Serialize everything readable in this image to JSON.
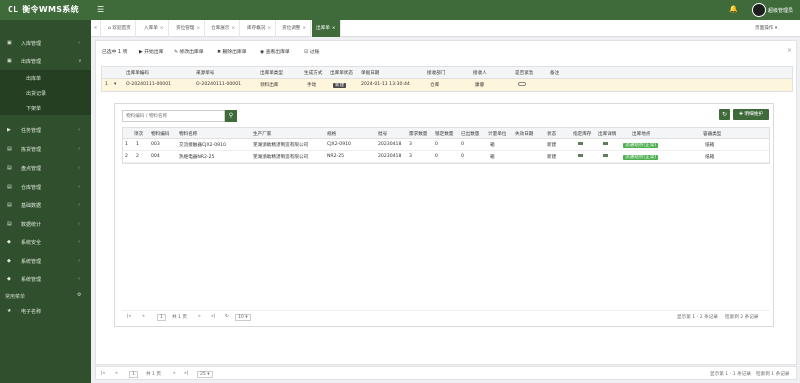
{
  "app": {
    "logo_mark": "CL",
    "title": "衡令WMS系统"
  },
  "header": {
    "menu_icon": "menu-icon",
    "notify_icon": "bell-icon",
    "user_name": "超级管理员"
  },
  "sidebar": {
    "items": [
      {
        "icon": "▣",
        "label": "入库管理",
        "arrow": "‹"
      },
      {
        "icon": "▣",
        "label": "出库管理",
        "arrow": "∨"
      },
      {
        "icon": "▶",
        "label": "任务管理",
        "arrow": "‹"
      },
      {
        "icon": "▤",
        "label": "拣货管理",
        "arrow": "‹"
      },
      {
        "icon": "▤",
        "label": "盘点管理",
        "arrow": "‹"
      },
      {
        "icon": "▤",
        "label": "仓库管理",
        "arrow": "‹"
      },
      {
        "icon": "▤",
        "label": "基础数据",
        "arrow": "‹"
      },
      {
        "icon": "▤",
        "label": "数据统计",
        "arrow": "‹"
      },
      {
        "icon": "◆",
        "label": "系统安全",
        "arrow": "‹"
      },
      {
        "icon": "◆",
        "label": "系统管理",
        "arrow": "‹"
      },
      {
        "icon": "◆",
        "label": "系统管理",
        "arrow": "‹"
      }
    ],
    "subitems": [
      {
        "label": "出库单"
      },
      {
        "label": "出货记录"
      },
      {
        "label": "下架单"
      }
    ],
    "section_title": "常用菜单",
    "fav": {
      "icon": "★",
      "label": "电子名称"
    }
  },
  "tabs": {
    "prev": "«",
    "home": "⌂",
    "items": [
      {
        "label": "欢迎首页",
        "close": ""
      },
      {
        "label": "入库单",
        "close": "×"
      },
      {
        "label": "货位管理",
        "close": "×"
      },
      {
        "label": "仓库展示",
        "close": "×"
      },
      {
        "label": "库存概况",
        "close": "×"
      },
      {
        "label": "货位调整",
        "close": "×"
      },
      {
        "label": "出库单",
        "close": "×"
      }
    ],
    "next": "»",
    "page_ops": "页面操作 ▾"
  },
  "toolbar": {
    "selected": "已选中 1 项",
    "buttons": [
      "▶ 开始出库",
      "✎ 修改出库单",
      "✖ 删除出库单",
      "◉ 查看出库单",
      "☑ 过账"
    ]
  },
  "order_grid": {
    "headers": [
      "出库单编码",
      "来源单号",
      "出库单类型",
      "生成方式",
      "出库单状态",
      "单据日期",
      "接收部门",
      "接收人",
      "是否紧急",
      "备注"
    ],
    "row": {
      "index": "1",
      "expand": "▾",
      "cells": [
        "O-20240111-00001",
        "O-20240111-00001",
        "领料出库",
        "手动",
        "新建",
        "2024-01-11 13:30:44",
        "仓库",
        "康睿",
        "",
        ""
      ]
    }
  },
  "detail": {
    "search_placeholder": "物料编码 / 物料名称",
    "search_icon": "search-icon",
    "refresh_icon": "refresh-icon",
    "add_label": "✚ 明细维护",
    "headers": [
      "项次",
      "物料编码",
      "物料名称",
      "生产厂家",
      "规格",
      "批号",
      "需求数量",
      "锁定数量",
      "已出数量",
      "计量单位",
      "失效日期",
      "状态",
      "指定库存",
      "出库详情",
      "出库地点",
      "容器类型"
    ],
    "rows": [
      {
        "num": "1",
        "seq": "1",
        "code": "003",
        "name": "交流接触器CJX2-0910",
        "maker": "芜湖浙助精湛制造有限公司",
        "spec": "CJX2-0910",
        "batch": "20230418",
        "req": "3",
        "lock": "0",
        "out": "0",
        "unit": "箱",
        "expire": "",
        "status": "新建",
        "loc": "流通站点(正常)",
        "container": "纸箱"
      },
      {
        "num": "2",
        "seq": "2",
        "code": "004",
        "name": "热继电器NR2-25",
        "maker": "芜湖浙助精湛制造有限公司",
        "spec": "NR2-25",
        "batch": "20230418",
        "req": "3",
        "lock": "0",
        "out": "0",
        "unit": "箱",
        "expire": "",
        "status": "新建",
        "loc": "流通站点(正常)",
        "container": "纸箱"
      }
    ],
    "pager": {
      "first": "|«",
      "prev": "«",
      "page": "1",
      "total": "共 1 页",
      "next": "»",
      "last": "»|",
      "refresh": "↻",
      "size": "10 ▾",
      "summary": "显示第 1 - 2 条记录",
      "found": "检索到 2 条记录"
    }
  },
  "main_pager": {
    "first": "|«",
    "prev": "«",
    "page": "1",
    "total": "共 1 页",
    "next": "»",
    "last": "»|",
    "refresh": "↻",
    "size": "25 ▾",
    "summary": "显示第 1 - 1 条记录",
    "found": "检索到 1 条记录"
  },
  "colors": {
    "brand": "#3f6b3a",
    "sidebar": "#2f4f2d",
    "row_highlight": "#fdf6dc"
  }
}
